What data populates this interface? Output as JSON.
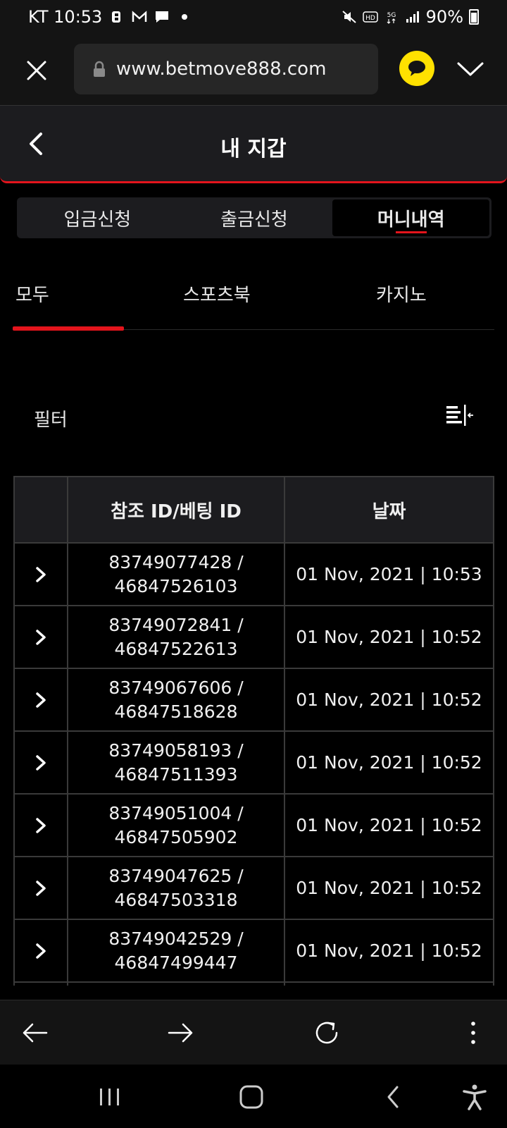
{
  "status_bar": {
    "carrier_time": "KT 10:53",
    "notif_icons": [
      "b-icon",
      "m-icon",
      "chat-icon",
      "dot-icon"
    ],
    "battery": "90%",
    "network": "5G"
  },
  "browser": {
    "url": "www.betmove888.com"
  },
  "header": {
    "title": "내 지갑"
  },
  "segments": [
    {
      "label": "입금신청",
      "active": false
    },
    {
      "label": "출금신청",
      "active": false
    },
    {
      "label": "머니내역",
      "active": true
    }
  ],
  "subtabs": [
    {
      "label": "모두",
      "active": true
    },
    {
      "label": "스포츠북",
      "active": false
    },
    {
      "label": "카지노",
      "active": false
    }
  ],
  "filter": {
    "label": "필터"
  },
  "table": {
    "columns": [
      "",
      "참조 ID/베팅 ID",
      "날짜"
    ],
    "rows": [
      {
        "ref_id": "83749077428 /",
        "bet_id": "46847526103",
        "date": "01 Nov, 2021 | 10:53"
      },
      {
        "ref_id": "83749072841 /",
        "bet_id": "46847522613",
        "date": "01 Nov, 2021 | 10:52"
      },
      {
        "ref_id": "83749067606 /",
        "bet_id": "46847518628",
        "date": "01 Nov, 2021 | 10:52"
      },
      {
        "ref_id": "83749058193 /",
        "bet_id": "46847511393",
        "date": "01 Nov, 2021 | 10:52"
      },
      {
        "ref_id": "83749051004 /",
        "bet_id": "46847505902",
        "date": "01 Nov, 2021 | 10:52"
      },
      {
        "ref_id": "83749047625 /",
        "bet_id": "46847503318",
        "date": "01 Nov, 2021 | 10:52"
      },
      {
        "ref_id": "83749042529 /",
        "bet_id": "46847499447",
        "date": "01 Nov, 2021 | 10:52"
      }
    ]
  },
  "colors": {
    "accent": "#e3141c",
    "background": "#000000",
    "surface": "#1c1c1f",
    "kakao": "#ffe100"
  }
}
